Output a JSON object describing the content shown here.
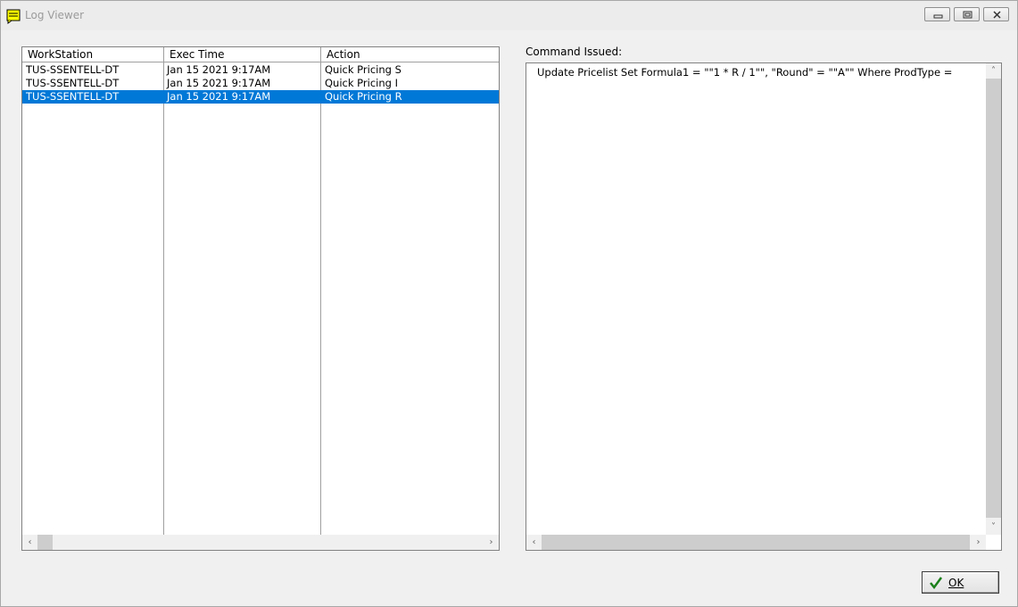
{
  "window": {
    "title": "Log Viewer",
    "controls": {
      "minimize": "minimize-icon",
      "restore": "restore-icon",
      "close": "close-icon"
    }
  },
  "log_list": {
    "columns": [
      "WorkStation",
      "Exec Time",
      "Action"
    ],
    "rows": [
      {
        "workstation": "TUS-SSENTELL-DT",
        "exec_time": "Jan 15 2021  9:17AM",
        "action": "Quick Pricing S",
        "selected": false
      },
      {
        "workstation": "TUS-SSENTELL-DT",
        "exec_time": "Jan 15 2021  9:17AM",
        "action": "Quick Pricing I",
        "selected": false
      },
      {
        "workstation": "TUS-SSENTELL-DT",
        "exec_time": "Jan 15 2021  9:17AM",
        "action": "Quick Pricing R",
        "selected": true
      }
    ],
    "scroll_left": "‹",
    "scroll_right": "›"
  },
  "command": {
    "label": "Command Issued:",
    "text": "Update Pricelist Set Formula1 = \"\"1 * R / 1\"\", \"Round\" = \"\"A\"\" Where ProdType =",
    "scroll_up": "˄",
    "scroll_down": "˅",
    "scroll_left": "‹",
    "scroll_right": "›"
  },
  "ok_button": {
    "label": "OK",
    "icon": "checkmark-icon"
  },
  "colors": {
    "selection": "#0078d7",
    "title_text": "#9b9b9b"
  }
}
